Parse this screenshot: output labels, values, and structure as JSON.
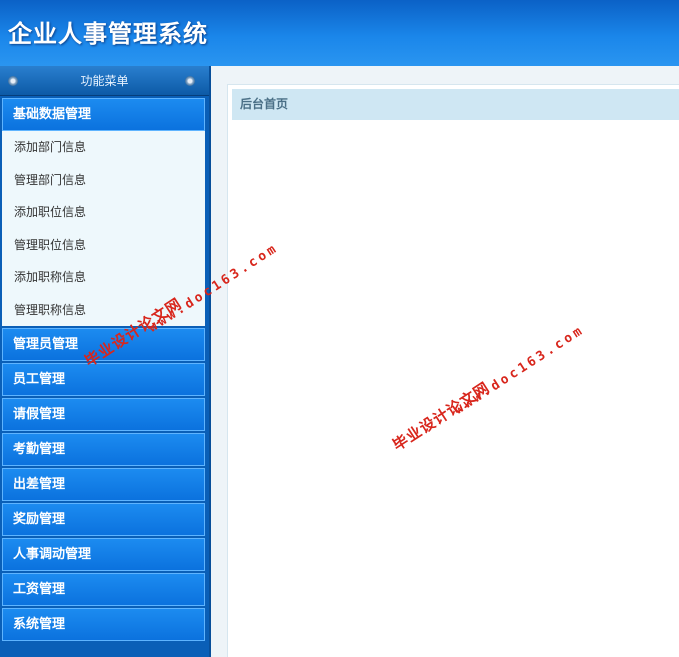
{
  "app": {
    "title": "企业人事管理系统"
  },
  "sidebar": {
    "header": "功能菜单",
    "open_group": "基础数据管理",
    "subitems": [
      "添加部门信息",
      "管理部门信息",
      "添加职位信息",
      "管理职位信息",
      "添加职称信息",
      "管理职称信息"
    ],
    "groups": [
      "管理员管理",
      "员工管理",
      "请假管理",
      "考勤管理",
      "出差管理",
      "奖励管理",
      "人事调动管理",
      "工资管理",
      "系统管理"
    ]
  },
  "main": {
    "breadcrumb": "后台首页"
  },
  "watermarks": {
    "site_name": "毕业设计论文网",
    "site_url": "www.doc163.com"
  }
}
